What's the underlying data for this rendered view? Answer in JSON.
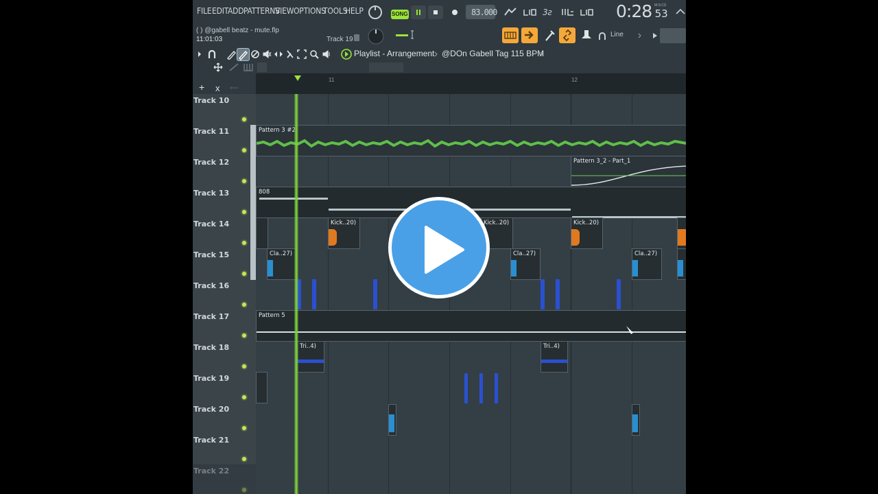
{
  "menu": [
    "FILE",
    "EDIT",
    "ADD",
    "PATTERNS",
    "VIEW",
    "OPTIONS",
    "TOOLS",
    "HELP"
  ],
  "transport": {
    "mode": "SONG",
    "tempo": "83.000",
    "time_main": "0:28",
    "time_sub": "53",
    "time_label": "M:S:CS"
  },
  "info": {
    "file": "(   ) @gabell beatz - mute.flp",
    "time": "11:01:03",
    "track": "Track 19",
    "snap": "Line"
  },
  "playlist": {
    "title": "Playlist - Arrangement",
    "pattern": "@DOn Gabell Tag 115 BPM"
  },
  "ruler": {
    "bar_11": "11",
    "bar_12": "12"
  },
  "tracks": [
    {
      "name": "Track 10"
    },
    {
      "name": "Track 11"
    },
    {
      "name": "Track 12"
    },
    {
      "name": "Track 13"
    },
    {
      "name": "Track 14"
    },
    {
      "name": "Track 15"
    },
    {
      "name": "Track 16"
    },
    {
      "name": "Track 17"
    },
    {
      "name": "Track 18"
    },
    {
      "name": "Track 19"
    },
    {
      "name": "Track 20"
    },
    {
      "name": "Track 21"
    },
    {
      "name": "Track 22"
    }
  ],
  "clips": {
    "pattern3_2": "Pattern 3 #2",
    "pattern3_2_part1": "Pattern 3_2 - Part_1",
    "b808": "808",
    "kick": "Kick..20)",
    "clap": "Cla..27)",
    "pattern5": "Pattern 5",
    "tri": "Tri..4)"
  },
  "colors": {
    "accent_green": "#7ed23a",
    "waveform_green": "#5fbf4a",
    "kick_orange": "#e07a20",
    "clap_blue": "#2a8fd0",
    "hat_blue": "#2a50d0",
    "play_overlay": "#4aa0e6"
  }
}
